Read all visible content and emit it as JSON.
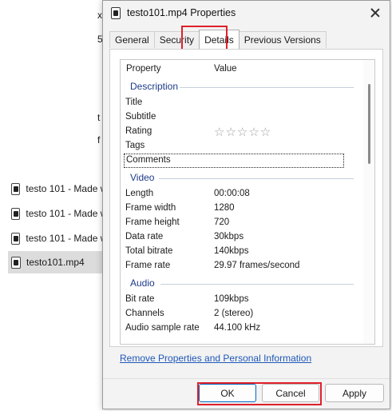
{
  "background_files": [
    {
      "name": "testo 101 - Made w",
      "selected": false
    },
    {
      "name": "testo 101 - Made w",
      "selected": false
    },
    {
      "name": "testo 101 - Made w",
      "selected": false
    },
    {
      "name": "testo101.mp4",
      "selected": true
    }
  ],
  "background_fragments": [
    "x",
    "5",
    "t",
    "f"
  ],
  "dialog": {
    "title": "testo101.mp4 Properties",
    "tabs": [
      "General",
      "Security",
      "Details",
      "Previous Versions"
    ],
    "active_tab": "Details",
    "columns": {
      "property": "Property",
      "value": "Value"
    },
    "groups": [
      {
        "name": "Description",
        "rows": [
          {
            "property": "Title",
            "value": ""
          },
          {
            "property": "Subtitle",
            "value": ""
          },
          {
            "property": "Rating",
            "value": "☆☆☆☆☆"
          },
          {
            "property": "Tags",
            "value": ""
          },
          {
            "property": "Comments",
            "value": ""
          }
        ]
      },
      {
        "name": "Video",
        "rows": [
          {
            "property": "Length",
            "value": "00:00:08"
          },
          {
            "property": "Frame width",
            "value": "1280"
          },
          {
            "property": "Frame height",
            "value": "720"
          },
          {
            "property": "Data rate",
            "value": "30kbps"
          },
          {
            "property": "Total bitrate",
            "value": "140kbps"
          },
          {
            "property": "Frame rate",
            "value": "29.97 frames/second"
          }
        ]
      },
      {
        "name": "Audio",
        "rows": [
          {
            "property": "Bit rate",
            "value": "109kbps"
          },
          {
            "property": "Channels",
            "value": "2 (stereo)"
          },
          {
            "property": "Audio sample rate",
            "value": "44.100 kHz"
          }
        ]
      }
    ],
    "remove_link": "Remove Properties and Personal Information",
    "buttons": {
      "ok": "OK",
      "cancel": "Cancel",
      "apply": "Apply"
    },
    "highlight_color": "#e0202a"
  }
}
